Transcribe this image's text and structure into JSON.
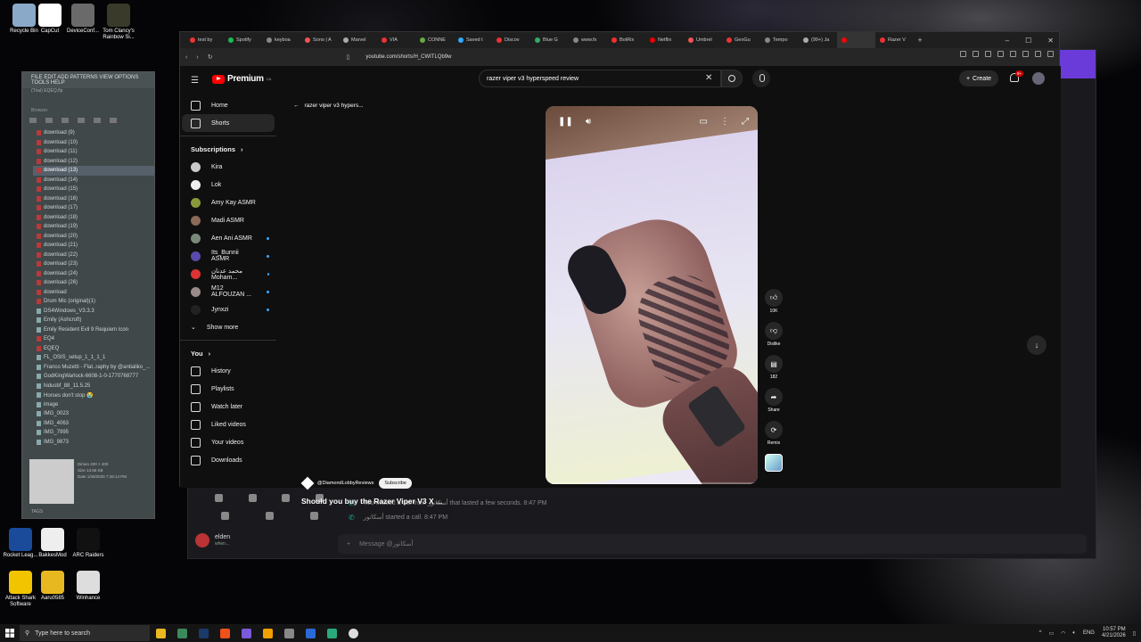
{
  "desktop": {
    "icons": [
      {
        "label": "Recycle Bin",
        "color": "#8aa9c8"
      },
      {
        "label": "CapCut",
        "color": "#ffffff"
      },
      {
        "label": "DeviceConf...",
        "color": "#6a6a6a"
      },
      {
        "label": "Tom Clancy's Rainbow Si...",
        "color": "#3a3a2a"
      }
    ],
    "bottom_icons": [
      {
        "label": "Rocket Leag...",
        "color": "#1a4a9a"
      },
      {
        "label": "BakkesMod",
        "color": "#eeeeee"
      },
      {
        "label": "ARC Raiders",
        "color": "#111111"
      },
      {
        "label": "Attack Shark Software",
        "color": "#f2c400"
      },
      {
        "label": "Aaru0585",
        "color": "#e8b820"
      },
      {
        "label": "Winhance",
        "color": "#dddddd"
      }
    ]
  },
  "taskbar": {
    "search_placeholder": "Type here to search",
    "language": "ENG",
    "time": "10:57 PM",
    "date": "4/21/2026"
  },
  "file_manager": {
    "menu": "FILE EDIT ADD PATTERNS VIEW OPTIONS TOOLS HELP",
    "subtitle": "(Trial) EQEQ.flp",
    "browser_label": "Browser",
    "items": [
      "download (9)",
      "download (10)",
      "download (11)",
      "download (12)",
      "download (13)",
      "download (14)",
      "download (15)",
      "download (16)",
      "download (17)",
      "download (18)",
      "download (19)",
      "download (20)",
      "download (21)",
      "download (22)",
      "download (23)",
      "download (24)",
      "download (26)",
      "download",
      "Drum Mic (original)(1)",
      "DS4Windows_V3.3.3",
      "Emily (Ashcroft)",
      "Emily Resident Evil 9 Requiem Icon",
      "EQ4",
      "EQEQ",
      "FL_OSIS_setup_1_1_1_1",
      "Franco Muzetti - Flat..raphy by @antialiko_...",
      "GodKingWarlock-6608-1-0-1770768777",
      "hidusbf_88_11.5.25",
      "Horses don't stop 😭",
      "image",
      "IMG_0023",
      "IMG_4063",
      "IMG_7995",
      "IMG_9873"
    ],
    "selected_index": 4,
    "meta": [
      "Dimen 400 × 400",
      "Size 13.56 KB",
      "Date 1/26/2026 7:26:14 PM"
    ],
    "footer": "TAGS"
  },
  "discord": {
    "messages": [
      "You missed a call from أسكاتور that lasted a few seconds. 8:47 PM",
      "أسكاتور started a call. 8:47 PM"
    ],
    "user_name": "elden",
    "user_status": "when...",
    "input_placeholder": "Message @أسكاتور"
  },
  "browser": {
    "tabs": [
      {
        "title": "test by",
        "color": "#e33"
      },
      {
        "title": "Spotify",
        "color": "#1db954"
      },
      {
        "title": "keyboa",
        "color": "#888"
      },
      {
        "title": "Sono | A",
        "color": "#e55"
      },
      {
        "title": "Marvel",
        "color": "#aaa"
      },
      {
        "title": "VIA",
        "color": "#e33"
      },
      {
        "title": "CONNE",
        "color": "#6a4"
      },
      {
        "title": "Saved t",
        "color": "#3af"
      },
      {
        "title": "Discov",
        "color": "#e33"
      },
      {
        "title": "Blue G",
        "color": "#3a6"
      },
      {
        "title": "www.fx",
        "color": "#888"
      },
      {
        "title": "BotRix",
        "color": "#e33"
      },
      {
        "title": "Netflix",
        "color": "#e00"
      },
      {
        "title": "Umbrel",
        "color": "#e55"
      },
      {
        "title": "GeoGu",
        "color": "#e33"
      },
      {
        "title": "Tempo",
        "color": "#888"
      },
      {
        "title": "(99+) Ja",
        "color": "#aaa"
      },
      {
        "title": "",
        "color": "#f00"
      },
      {
        "title": "Razer V",
        "color": "#e33"
      }
    ],
    "active_tab": 17,
    "url": "youtube.com/shorts/H_CWITLQb9w"
  },
  "youtube": {
    "logo_text": "Premium",
    "logo_sup": "CA",
    "search_query": "razer viper v3 hyperspeed review",
    "create_label": "Create",
    "notif_badge": "9+",
    "sidebar_main": [
      {
        "label": "Home",
        "icon": "home-icon"
      },
      {
        "label": "Shorts",
        "icon": "shorts-icon",
        "active": true
      }
    ],
    "subscriptions_label": "Subscriptions",
    "subscriptions": [
      {
        "label": "Kira",
        "color": "#c9c9c9",
        "dot": false
      },
      {
        "label": "Lok",
        "color": "#eeeeee",
        "dot": false
      },
      {
        "label": "Amy Kay ASMR",
        "color": "#8a9a3a",
        "dot": false
      },
      {
        "label": "Madi ASMR",
        "color": "#8a6a5a",
        "dot": false
      },
      {
        "label": "Aen Ani ASMR",
        "color": "#7a8a7a",
        "dot": true
      },
      {
        "label": "Its_Bunnii ASMR",
        "color": "#5a4aaa",
        "dot": true
      },
      {
        "label": "محمد عدنان Moham...",
        "color": "#d33",
        "dot": true
      },
      {
        "label": "M12 ALFOUZAN ...",
        "color": "#9a8a8a",
        "dot": true
      },
      {
        "label": "Jynxzi",
        "color": "#222222",
        "dot": true
      }
    ],
    "show_more": "Show more",
    "you_label": "You",
    "you_items": [
      {
        "label": "History",
        "icon": "history-icon"
      },
      {
        "label": "Playlists",
        "icon": "playlists-icon"
      },
      {
        "label": "Watch later",
        "icon": "clock-icon"
      },
      {
        "label": "Liked videos",
        "icon": "thumbs-up-icon"
      },
      {
        "label": "Your videos",
        "icon": "video-icon"
      },
      {
        "label": "Downloads",
        "icon": "download-icon"
      }
    ],
    "back_label": "razer viper v3 hypers...",
    "short": {
      "likes": "10K",
      "dislike": "Dislike",
      "comments": "182",
      "share": "Share",
      "remix": "Remix",
      "channel": "@DiamondLobbyReviews",
      "subscribe": "Subscribe",
      "title": "Should you buy the Razer Viper V3 X ...",
      "progress": 0.02
    }
  }
}
